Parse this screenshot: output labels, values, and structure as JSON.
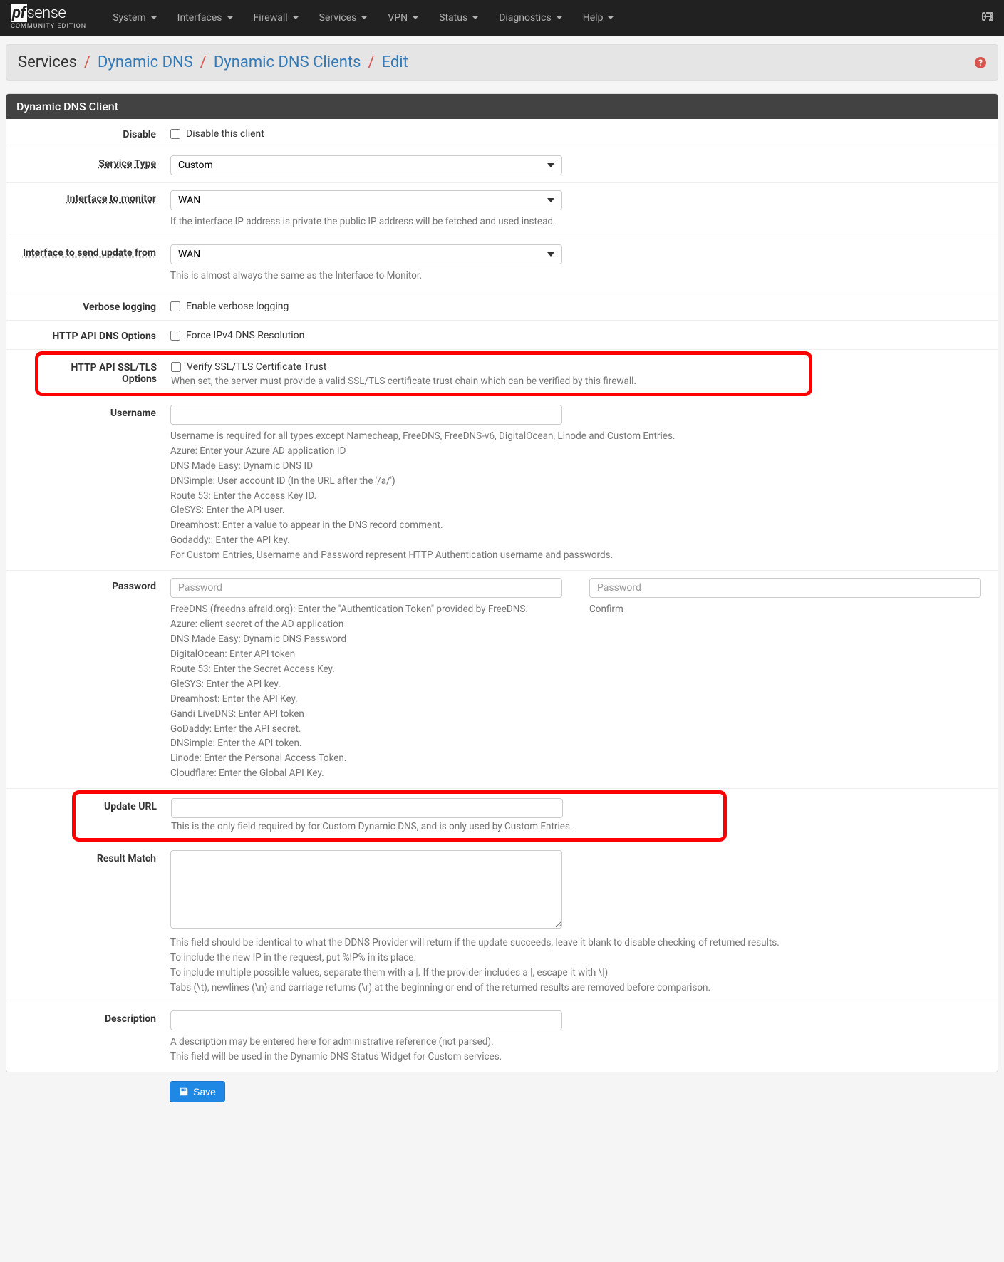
{
  "brand": {
    "logo_prefix": "pf",
    "logo_suffix": "sense",
    "edition": "COMMUNITY EDITION"
  },
  "nav": {
    "items": [
      "System",
      "Interfaces",
      "Firewall",
      "Services",
      "VPN",
      "Status",
      "Diagnostics",
      "Help"
    ]
  },
  "breadcrumb": {
    "items": [
      "Services",
      "Dynamic DNS",
      "Dynamic DNS Clients",
      "Edit"
    ]
  },
  "panel": {
    "title": "Dynamic DNS Client"
  },
  "fields": {
    "disable": {
      "label": "Disable",
      "checkbox": "Disable this client"
    },
    "service_type": {
      "label": "Service Type",
      "value": "Custom"
    },
    "interface_monitor": {
      "label": "Interface to monitor",
      "value": "WAN",
      "help": "If the interface IP address is private the public IP address will be fetched and used instead."
    },
    "interface_send": {
      "label": "Interface to send update from",
      "value": "WAN",
      "help": "This is almost always the same as the Interface to Monitor."
    },
    "verbose": {
      "label": "Verbose logging",
      "checkbox": "Enable verbose logging"
    },
    "http_dns": {
      "label": "HTTP API DNS Options",
      "checkbox": "Force IPv4 DNS Resolution"
    },
    "http_ssl": {
      "label": "HTTP API SSL/TLS Options",
      "checkbox": "Verify SSL/TLS Certificate Trust",
      "help": "When set, the server must provide a valid SSL/TLS certificate trust chain which can be verified by this firewall."
    },
    "username": {
      "label": "Username",
      "help_lines": [
        "Username is required for all types except Namecheap, FreeDNS, FreeDNS-v6, DigitalOcean, Linode and Custom Entries.",
        "Azure: Enter your Azure AD application ID",
        "DNS Made Easy: Dynamic DNS ID",
        "DNSimple: User account ID (In the URL after the '/a/')",
        "Route 53: Enter the Access Key ID.",
        "GleSYS: Enter the API user.",
        "Dreamhost: Enter a value to appear in the DNS record comment.",
        "Godaddy:: Enter the API key.",
        "For Custom Entries, Username and Password represent HTTP Authentication username and passwords."
      ]
    },
    "password": {
      "label": "Password",
      "placeholder": "Password",
      "confirm_placeholder": "Password",
      "confirm_label": "Confirm",
      "help_lines": [
        "FreeDNS (freedns.afraid.org): Enter the \"Authentication Token\" provided by FreeDNS.",
        "Azure: client secret of the AD application",
        "DNS Made Easy: Dynamic DNS Password",
        "DigitalOcean: Enter API token",
        "Route 53: Enter the Secret Access Key.",
        "GleSYS: Enter the API key.",
        "Dreamhost: Enter the API Key.",
        "Gandi LiveDNS: Enter API token",
        "GoDaddy: Enter the API secret.",
        "DNSimple: Enter the API token.",
        "Linode: Enter the Personal Access Token.",
        "Cloudflare: Enter the Global API Key."
      ]
    },
    "update_url": {
      "label": "Update URL",
      "help": "This is the only field required by for Custom Dynamic DNS, and is only used by Custom Entries."
    },
    "result_match": {
      "label": "Result Match",
      "help_lines": [
        "This field should be identical to what the DDNS Provider will return if the update succeeds, leave it blank to disable checking of returned results.",
        "To include the new IP in the request, put %IP% in its place.",
        "To include multiple possible values, separate them with a |. If the provider includes a |, escape it with \\|)",
        "Tabs (\\t), newlines (\\n) and carriage returns (\\r) at the beginning or end of the returned results are removed before comparison."
      ]
    },
    "description": {
      "label": "Description",
      "help_lines": [
        "A description may be entered here for administrative reference (not parsed).",
        "This field will be used in the Dynamic DNS Status Widget for Custom services."
      ]
    }
  },
  "buttons": {
    "save": "Save"
  }
}
